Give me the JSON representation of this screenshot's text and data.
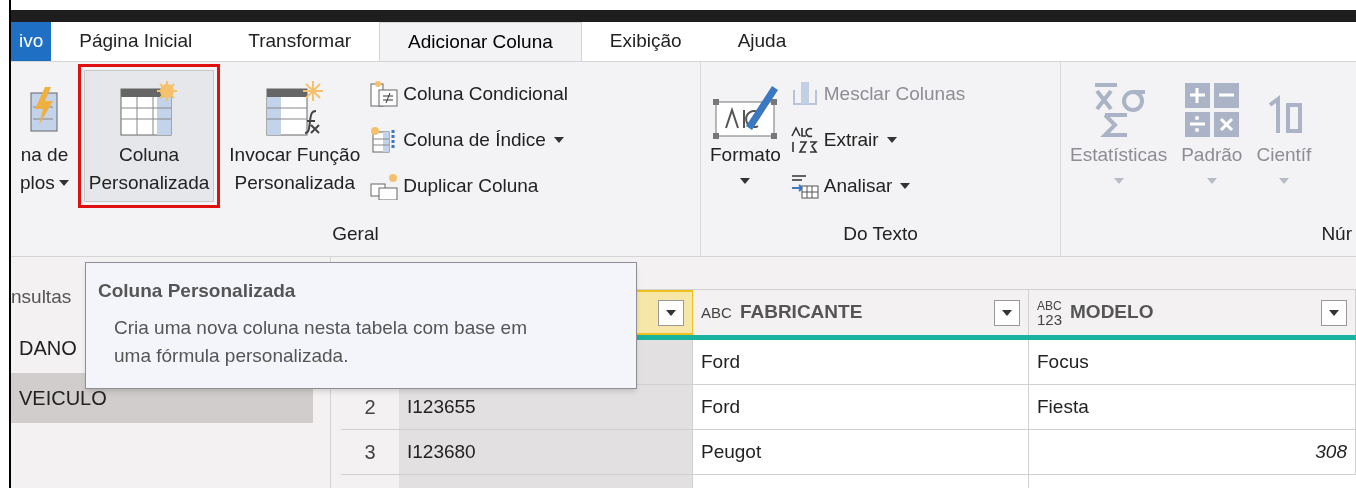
{
  "tabs": [
    {
      "label": "ivo",
      "kind": "file",
      "selected": false
    },
    {
      "label": "Página Inicial",
      "kind": "tab",
      "selected": false
    },
    {
      "label": "Transformar",
      "kind": "tab",
      "selected": false
    },
    {
      "label": "Adicionar Coluna",
      "kind": "tab",
      "selected": true
    },
    {
      "label": "Exibição",
      "kind": "tab",
      "selected": false
    },
    {
      "label": "Ajuda",
      "kind": "tab",
      "selected": false
    }
  ],
  "ribbon": {
    "groups": [
      {
        "label": "Geral",
        "items": [
          {
            "kind": "large",
            "lines": [
              "na de",
              "plos"
            ],
            "dropdown": true,
            "disabled": false,
            "highlighted": false
          },
          {
            "kind": "large",
            "lines": [
              "Coluna",
              "Personalizada"
            ],
            "dropdown": false,
            "disabled": false,
            "highlighted": true
          },
          {
            "kind": "large",
            "lines": [
              "Invocar Função",
              "Personalizada"
            ],
            "dropdown": false,
            "disabled": false,
            "highlighted": false
          },
          {
            "kind": "stack",
            "items": [
              {
                "label": "Coluna Condicional",
                "dropdown": false,
                "disabled": false
              },
              {
                "label": "Coluna de Índice",
                "dropdown": true,
                "disabled": false
              },
              {
                "label": "Duplicar Coluna",
                "dropdown": false,
                "disabled": false
              }
            ]
          }
        ]
      },
      {
        "label": "Do Texto",
        "items": [
          {
            "kind": "large",
            "lines": [
              "Formato"
            ],
            "dropdown": true,
            "disabled": false,
            "highlighted": false
          },
          {
            "kind": "stack",
            "items": [
              {
                "label": "Mesclar Colunas",
                "dropdown": false,
                "disabled": true
              },
              {
                "label": "Extrair",
                "dropdown": true,
                "disabled": false
              },
              {
                "label": "Analisar",
                "dropdown": true,
                "disabled": false
              }
            ]
          }
        ]
      },
      {
        "label": "Núr",
        "items": [
          {
            "kind": "large",
            "lines": [
              "Estatísticas"
            ],
            "dropdown": true,
            "disabled": true,
            "highlighted": false
          },
          {
            "kind": "large",
            "lines": [
              "Padrão"
            ],
            "dropdown": true,
            "disabled": true,
            "highlighted": false
          },
          {
            "kind": "large",
            "lines": [
              "Científ"
            ],
            "dropdown": true,
            "disabled": true,
            "highlighted": false
          }
        ]
      }
    ]
  },
  "queries": {
    "header": "nsultas",
    "items": [
      {
        "label": "DANO",
        "selected": false
      },
      {
        "label": "VEICULO",
        "selected": true
      }
    ]
  },
  "table": {
    "columns": [
      {
        "selected": true
      },
      {
        "kind": "text",
        "marks": [
          "A",
          "B",
          "C"
        ],
        "name": "FABRICANTE",
        "selected": false
      },
      {
        "kind": "any",
        "marks": [
          "ABC",
          "123"
        ],
        "name": "MODELO",
        "selected": false
      }
    ],
    "rows": [
      {
        "cells": [
          {
            "kind": "text"
          },
          {
            "kind": "text",
            "text": "Ford"
          },
          {
            "kind": "text",
            "text": "Focus"
          }
        ]
      },
      {
        "number": "2",
        "cells": [
          {
            "kind": "text",
            "text": "I123655"
          },
          {
            "kind": "text",
            "text": "Ford"
          },
          {
            "kind": "text",
            "text": "Fiesta"
          }
        ]
      },
      {
        "number": "3",
        "cells": [
          {
            "kind": "text",
            "text": "I123680"
          },
          {
            "kind": "text",
            "text": "Peugot"
          },
          {
            "kind": "number",
            "text": "308"
          }
        ]
      }
    ]
  },
  "tooltip": {
    "title": "Coluna Personalizada",
    "text": "Cria uma nova coluna nesta tabela com base em uma fórmula personalizada."
  }
}
